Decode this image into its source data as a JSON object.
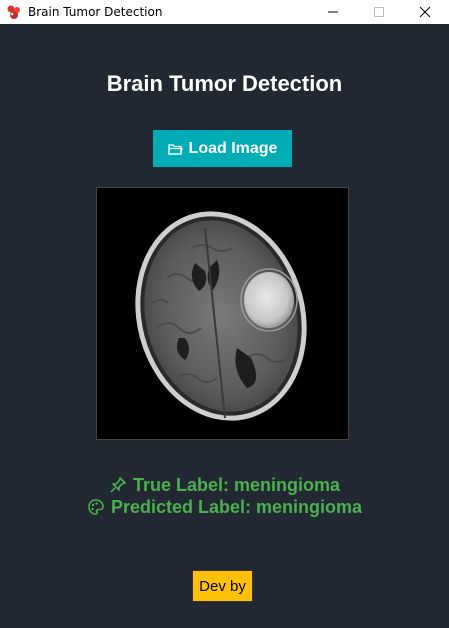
{
  "window": {
    "title": "Brain Tumor Detection"
  },
  "header": {
    "title": "Brain Tumor Detection"
  },
  "toolbar": {
    "load_label": "Load Image",
    "load_icon": "folder-icon"
  },
  "results": {
    "true_label": "True Label: meningioma",
    "true_icon": "pushpin-icon",
    "predicted_label": "Predicted Label: meningioma",
    "predicted_icon": "palette-icon"
  },
  "footer": {
    "dev_label": "Dev by"
  },
  "colors": {
    "background": "#222831",
    "accent": "#00adb5",
    "label_green": "#4caf50",
    "dev_button": "#ffc107"
  }
}
